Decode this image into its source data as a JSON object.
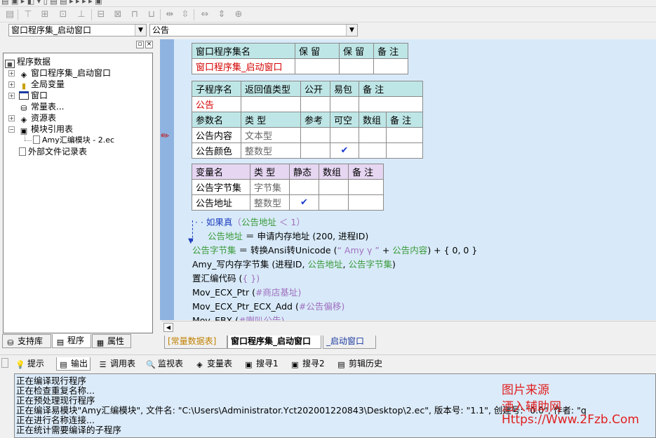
{
  "colors": {
    "editor_bg": "#d8eaf9",
    "table_header": "#bfe6e6",
    "var_header": "#e6d6f2",
    "red_text": "#d40000",
    "green_text": "#3a9a3a",
    "watermark": "#e02020"
  },
  "toolbar": {
    "combo_left": "窗口程序集_启动窗口",
    "combo_right": "公告"
  },
  "tree": {
    "root": "程序数据",
    "items": [
      {
        "label": "窗口程序集_启动窗口",
        "icon": "layers-icon"
      },
      {
        "label": "全局变量",
        "icon": "lock-icon"
      },
      {
        "label": "窗口",
        "icon": "window-icon"
      },
      {
        "label": "常量表...",
        "icon": "constants-icon"
      },
      {
        "label": "资源表",
        "icon": "resource-icon"
      },
      {
        "label": "模块引用表",
        "icon": "module-icon"
      },
      {
        "label": "Amy汇编模块 - 2.ec",
        "icon": "doc-icon"
      },
      {
        "label": "外部文件记录表",
        "icon": "doc-icon"
      }
    ],
    "tabs": [
      "支持库",
      "程序",
      "属性"
    ]
  },
  "assembly_table": {
    "headers": [
      "窗口程序集名",
      "保 留",
      "保 留",
      "备 注"
    ],
    "row": [
      "窗口程序集_启动窗口",
      "",
      "",
      ""
    ]
  },
  "sub_table": {
    "headers": [
      "子程序名",
      "返回值类型",
      "公开",
      "易包",
      "备 注"
    ],
    "row": [
      "公告",
      "",
      "",
      "",
      ""
    ],
    "param_headers": [
      "参数名",
      "类 型",
      "参考",
      "可空",
      "数组",
      "备 注"
    ],
    "params": [
      {
        "name": "公告内容",
        "type": "文本型",
        "nullable": false
      },
      {
        "name": "公告颜色",
        "type": "整数型",
        "nullable": true
      }
    ]
  },
  "var_table": {
    "headers": [
      "变量名",
      "类 型",
      "静态",
      "数组",
      "备 注"
    ],
    "rows": [
      {
        "name": "公告字节集",
        "type": "字节集",
        "static": false
      },
      {
        "name": "公告地址",
        "type": "整数型",
        "static": true
      }
    ]
  },
  "code": {
    "l1_kw": "如果真",
    "l1_open": "（",
    "l1_var": "公告地址",
    "l1_rest": " ＜ 1）",
    "l2_var": "公告地址",
    "l2_rest": " ＝ 申请内存地址 (200, 进程ID)",
    "l3_var": "公告字节集",
    "l3_rest1": " ＝ 转换Ansi转Unicode (",
    "l3_str": "“ Amy γ ” ",
    "l3_rest2": " + ",
    "l3_var2": "公告内容",
    "l3_rest3": ") + { 0, 0 }",
    "l4_a": "Amy_写内存字节集 (进程ID, ",
    "l4_v1": "公告地址",
    "l4_b": ", ",
    "l4_v2": "公告字节集",
    "l4_c": ")",
    "l5_a": "置汇编代码 (",
    "l5_b": "{ }",
    "l5_c": ")",
    "l6_a": "Mov_ECX_Ptr (",
    "l6_b": "#商店基址",
    "l6_c": ")",
    "l7_a": "Mov_ECX_Ptr_ECX_Add (",
    "l7_b": "#公告偏移",
    "l7_c": ")",
    "l8_a": "Mov_EBX (",
    "l8_b": "#喇叭公告",
    "l8_c": ")"
  },
  "file_tabs": [
    "[常量数据表]",
    "窗口程序集_启动窗口",
    "_启动窗口"
  ],
  "bottom_tabs": [
    {
      "label": "提示",
      "icon": "hint-icon"
    },
    {
      "label": "输出",
      "icon": "output-icon"
    },
    {
      "label": "调用表",
      "icon": "call-table-icon"
    },
    {
      "label": "监视表",
      "icon": "magnifier-icon"
    },
    {
      "label": "变量表",
      "icon": "variables-icon"
    },
    {
      "label": "搜寻1",
      "icon": "search1-icon"
    },
    {
      "label": "搜寻2",
      "icon": "search2-icon"
    },
    {
      "label": "剪辑历史",
      "icon": "clipboard-icon"
    }
  ],
  "output_lines": [
    "正在编译现行程序",
    "正在检查重复名称...",
    "正在预处理现行程序",
    "正在编译易模块\"Amy汇编模块\", 文件名: \"C:\\Users\\Administrator.Yct202001220843\\Desktop\\2.ec\", 版本号: \"1.1\", 创建号: \"0.0\", 作者: \"q",
    "正在进行名称连接...",
    "正在统计需要编译的子程序"
  ],
  "watermark": [
    "图片来源",
    "洒入辅助网",
    "Https://Www.2Fzb.Com"
  ]
}
